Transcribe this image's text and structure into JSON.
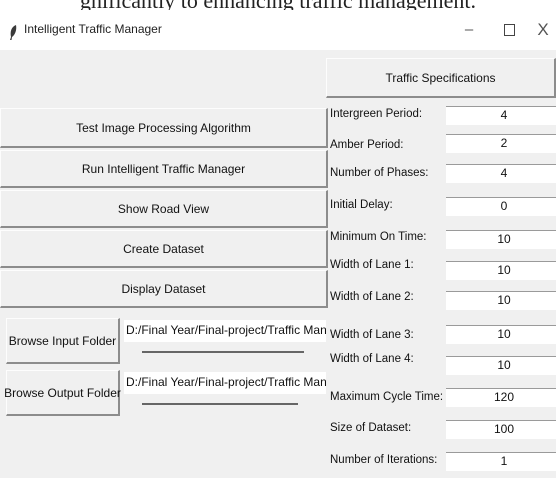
{
  "heading_fragment": "gnificantly to enhancing traffic management.",
  "window": {
    "title": "Intelligent Traffic Manager",
    "controls": {
      "minimize": "–",
      "close": "X"
    }
  },
  "buttons": {
    "test_algorithm": "Test Image Processing Algorithm",
    "run_manager": "Run Intelligent Traffic Manager",
    "show_road_view": "Show Road View",
    "create_dataset": "Create Dataset",
    "display_dataset": "Display Dataset",
    "browse_input": "Browse Input Folder",
    "browse_output": "Browse Output Folder"
  },
  "paths": {
    "input_folder": "D:/Final Year/Final-project/Traffic Manager/inp",
    "output_folder": "D:/Final Year/Final-project/Traffic Manager/ou"
  },
  "specs": {
    "header": "Traffic Specifications",
    "items": [
      {
        "label": "Intergreen Period:",
        "value": "4"
      },
      {
        "label": "Amber Period:",
        "value": "2"
      },
      {
        "label": "Number of Phases:",
        "value": "4"
      },
      {
        "label": "Initial Delay:",
        "value": "0"
      },
      {
        "label": "Minimum On Time:",
        "value": "10"
      },
      {
        "label": "Width of Lane 1:",
        "value": "10"
      },
      {
        "label": "Width of Lane 2:",
        "value": "10"
      },
      {
        "label": "Width of Lane 3:",
        "value": "10"
      },
      {
        "label": "Width of Lane 4:",
        "value": "10"
      },
      {
        "label": "Maximum Cycle Time:",
        "value": "120"
      },
      {
        "label": "Size of Dataset:",
        "value": "100"
      },
      {
        "label": "Number of Iterations:",
        "value": "1"
      }
    ]
  },
  "icons": {
    "app": "feather-icon",
    "minimize": "minimize-icon",
    "maximize": "maximize-icon",
    "close": "close-icon"
  }
}
